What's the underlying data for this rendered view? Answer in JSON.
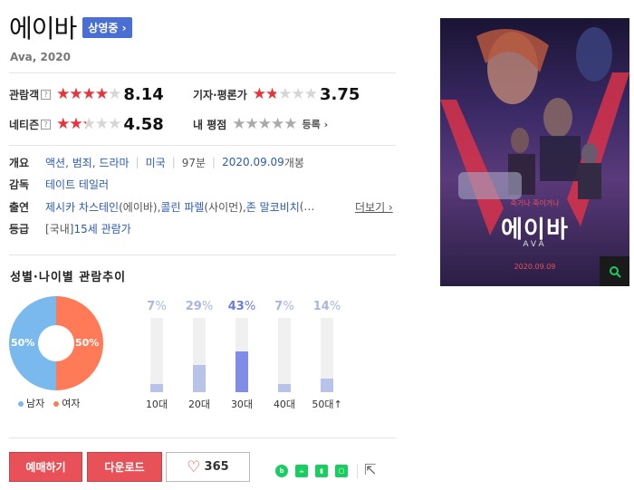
{
  "movie": {
    "title": "에이바",
    "status_badge": "상영중 ›",
    "original_title": "Ava, 2020"
  },
  "ratings": {
    "audience_label": "관람객",
    "audience_score": "8.14",
    "audience_fill_pct": 81.4,
    "critic_label": "기자·평론가",
    "critic_score": "3.75",
    "critic_fill_pct": 37.5,
    "netizen_label": "네티즌",
    "netizen_score": "4.58",
    "netizen_fill_pct": 45.8,
    "my_label": "내 평점",
    "register_label": "등록 ›",
    "help_glyph": "?"
  },
  "info": {
    "summary_label": "개요",
    "genres": "액션, 범죄, 드라마",
    "country": "미국",
    "runtime": "97분",
    "release_date": "2020.09.09",
    "release_suffix": " 개봉",
    "director_label": "감독",
    "director": "테이트 테일러",
    "cast_label": "출연",
    "cast_1": "제시카 차스테인",
    "cast_1_role": "(에이바), ",
    "cast_2": "콜린 파렐",
    "cast_2_role": "(사이먼), ",
    "cast_3": "존 말코비치",
    "cast_3_role": "(…",
    "more_label": "더보기 ›",
    "rating_label": "등급",
    "rating_prefix": "[국내] ",
    "rating_value": "15세 관람가"
  },
  "demographics": {
    "section_title": "성별·나이별 관람추이",
    "male_pct": "50%",
    "female_pct": "50%",
    "male_label": "남자",
    "female_label": "여자",
    "male_color": "#7ab9ee",
    "female_color": "#ff7a57",
    "ages": [
      {
        "label": "10대",
        "pct": "7",
        "value": 7,
        "highlight": false
      },
      {
        "label": "20대",
        "pct": "29",
        "value": 29,
        "highlight": false
      },
      {
        "label": "30대",
        "pct": "43",
        "value": 43,
        "highlight": true
      },
      {
        "label": "40대",
        "pct": "7",
        "value": 7,
        "highlight": false
      },
      {
        "label": "50대",
        "pct": "14",
        "value": 14,
        "highlight": false
      }
    ],
    "pct_unit": "%",
    "age_50_suffix": "↑"
  },
  "actions": {
    "reserve_label": "예매하기",
    "download_label": "다운로드",
    "like_count": "365",
    "share_icons": [
      "blog-icon",
      "cafe-icon",
      "bookmark-icon",
      "memo-icon"
    ],
    "brand_green": "#19ce60",
    "accent_red": "#e85158"
  },
  "poster": {
    "tagline": "죽거나 죽이거나",
    "title": "에이바",
    "sub": "AVA",
    "date": "2020.09.09"
  }
}
